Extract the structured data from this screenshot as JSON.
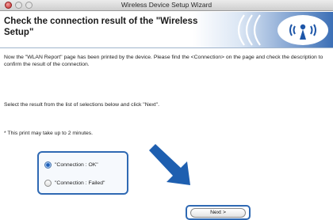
{
  "window": {
    "title": "Wireless Device Setup Wizard"
  },
  "header": {
    "title": "Check the connection result of the \"Wireless Setup\""
  },
  "body": {
    "instructions": "Now the \"WLAN Report\" page has been printed by the device. Please find the <Connection> on the page and check the description to confirm the result of the connection.",
    "select_prompt": "Select the result from the list of selections below and click \"Next\".",
    "note": "* This print may take up to 2 minutes."
  },
  "options": [
    {
      "label": "\"Connection : OK\"",
      "selected": true
    },
    {
      "label": "\"Connection : Failed\"",
      "selected": false
    }
  ],
  "buttons": {
    "next": "Next >"
  },
  "colors": {
    "highlight": "#2f69b3",
    "header_gradient_end": "#3c6fb6"
  }
}
